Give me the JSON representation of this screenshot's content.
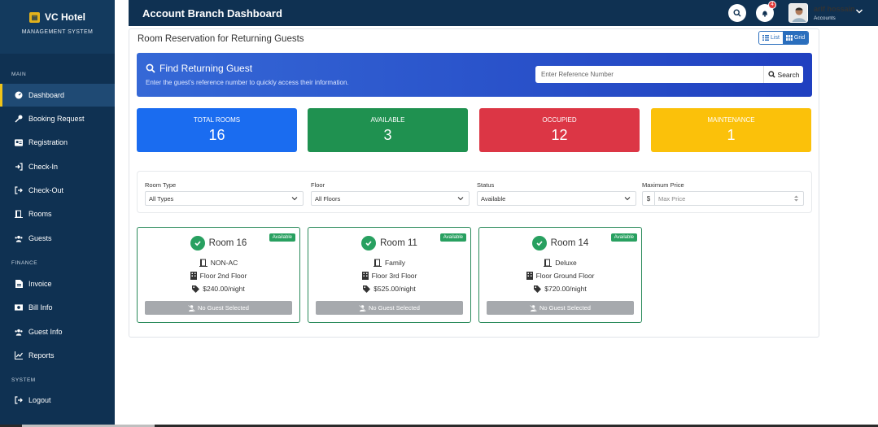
{
  "sidebar": {
    "brand_title": "VC Hotel",
    "brand_sub": "MANAGEMENT SYSTEM",
    "sections": {
      "main": "MAIN",
      "finance": "FINANCE",
      "system": "SYSTEM"
    },
    "items": [
      {
        "label": "Dashboard",
        "icon": "dashboard-icon"
      },
      {
        "label": "Booking Request",
        "icon": "key-icon"
      },
      {
        "label": "Registration",
        "icon": "id-card-icon"
      },
      {
        "label": "Check-In",
        "icon": "sign-in-icon"
      },
      {
        "label": "Check-Out",
        "icon": "sign-out-icon"
      },
      {
        "label": "Rooms",
        "icon": "door-icon"
      },
      {
        "label": "Guests",
        "icon": "users-icon"
      },
      {
        "label": "Invoice",
        "icon": "invoice-icon"
      },
      {
        "label": "Bill Info",
        "icon": "money-icon"
      },
      {
        "label": "Guest Info",
        "icon": "users-icon"
      },
      {
        "label": "Reports",
        "icon": "chart-icon"
      },
      {
        "label": "Logout",
        "icon": "logout-icon"
      }
    ],
    "active": "Dashboard",
    "accent": "#f0c419"
  },
  "header": {
    "title": "Account Branch Dashboard",
    "notification_count": "4",
    "user_name": "arif hossain",
    "user_role": "Accounts"
  },
  "main": {
    "title": "Room Reservation for Returning Guests",
    "view_list": "List",
    "view_grid": "Grid",
    "find": {
      "title": "Find Returning Guest",
      "subtitle": "Enter the guest's reference number to quickly access their information.",
      "placeholder": "Enter Reference Number",
      "button": "Search"
    },
    "stats": [
      {
        "label": "TOTAL ROOMS",
        "value": "16",
        "color": "#1a6cf0"
      },
      {
        "label": "AVAILABLE",
        "value": "3",
        "color": "#1f9150"
      },
      {
        "label": "OCCUPIED",
        "value": "12",
        "color": "#dc3645"
      },
      {
        "label": "MAINTENANCE",
        "value": "1",
        "color": "#fbc10a"
      }
    ],
    "filters": {
      "room_type_label": "Room Type",
      "room_type_value": "All Types",
      "floor_label": "Floor",
      "floor_value": "All Floors",
      "status_label": "Status",
      "status_value": "Available",
      "price_label": "Maximum Price",
      "price_prefix": "$",
      "price_placeholder": "Max Price"
    },
    "rooms": [
      {
        "name": "Room 16",
        "badge": "Available",
        "type": "NON-AC",
        "floor": "Floor 2nd Floor",
        "price": "$240.00/night",
        "guest": "No Guest Selected"
      },
      {
        "name": "Room 11",
        "badge": "Available",
        "type": "Family",
        "floor": "Floor 3rd Floor",
        "price": "$525.00/night",
        "guest": "No Guest Selected"
      },
      {
        "name": "Room 14",
        "badge": "Available",
        "type": "Deluxe",
        "floor": "Floor Ground Floor",
        "price": "$720.00/night",
        "guest": "No Guest Selected"
      }
    ]
  }
}
